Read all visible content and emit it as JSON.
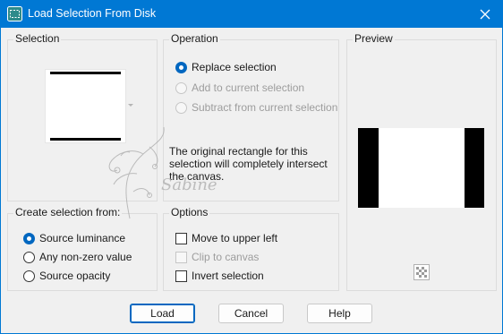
{
  "window": {
    "title": "Load Selection From Disk"
  },
  "selection": {
    "legend": "Selection"
  },
  "operation": {
    "legend": "Operation",
    "options": [
      {
        "label": "Replace selection",
        "checked": true,
        "disabled": false
      },
      {
        "label": "Add to current selection",
        "checked": false,
        "disabled": true
      },
      {
        "label": "Subtract from current selection",
        "checked": false,
        "disabled": true
      }
    ],
    "info": "The original rectangle for this selection will completely intersect the canvas."
  },
  "preview": {
    "legend": "Preview"
  },
  "create_from": {
    "legend": "Create selection from:",
    "options": [
      {
        "label": "Source luminance",
        "checked": true
      },
      {
        "label": "Any non-zero value",
        "checked": false
      },
      {
        "label": "Source opacity",
        "checked": false
      }
    ]
  },
  "options": {
    "legend": "Options",
    "items": [
      {
        "label": "Move to upper left",
        "checked": false,
        "disabled": false
      },
      {
        "label": "Clip to canvas",
        "checked": false,
        "disabled": true
      },
      {
        "label": "Invert selection",
        "checked": false,
        "disabled": false
      }
    ]
  },
  "buttons": {
    "load": "Load",
    "cancel": "Cancel",
    "help": "Help"
  },
  "watermark": {
    "text": "Sabine"
  },
  "colors": {
    "accent": "#0078d4",
    "dialog_bg": "#f0f0f0",
    "radio_checked": "#0067c0"
  },
  "icons": {
    "app": "selection-app-icon",
    "close": "close-icon",
    "transparency": "checkerboard-icon"
  }
}
